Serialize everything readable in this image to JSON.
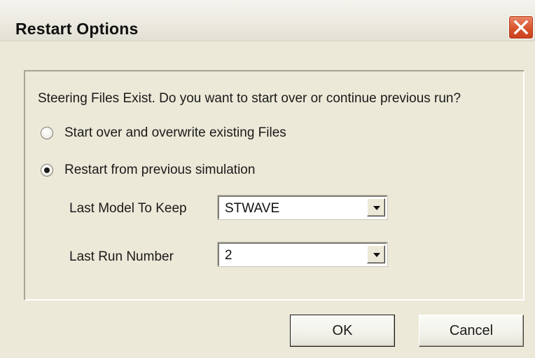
{
  "window": {
    "title": "Restart Options"
  },
  "dialog": {
    "question": "Steering Files Exist.  Do you want to start over or continue previous run?",
    "options": [
      {
        "label": "Start over and overwrite existing Files",
        "checked": false
      },
      {
        "label": "Restart from previous simulation",
        "checked": true
      }
    ],
    "fields": {
      "last_model": {
        "label": "Last Model To Keep",
        "value": "STWAVE"
      },
      "last_run": {
        "label": "Last Run Number",
        "value": "2"
      }
    }
  },
  "buttons": {
    "ok": "OK",
    "cancel": "Cancel"
  },
  "icons": {
    "close": "close-icon",
    "dropdown": "chevron-down-icon"
  },
  "colors": {
    "close_button": "#d8542c",
    "dialog_bg": "#ece9d8"
  }
}
